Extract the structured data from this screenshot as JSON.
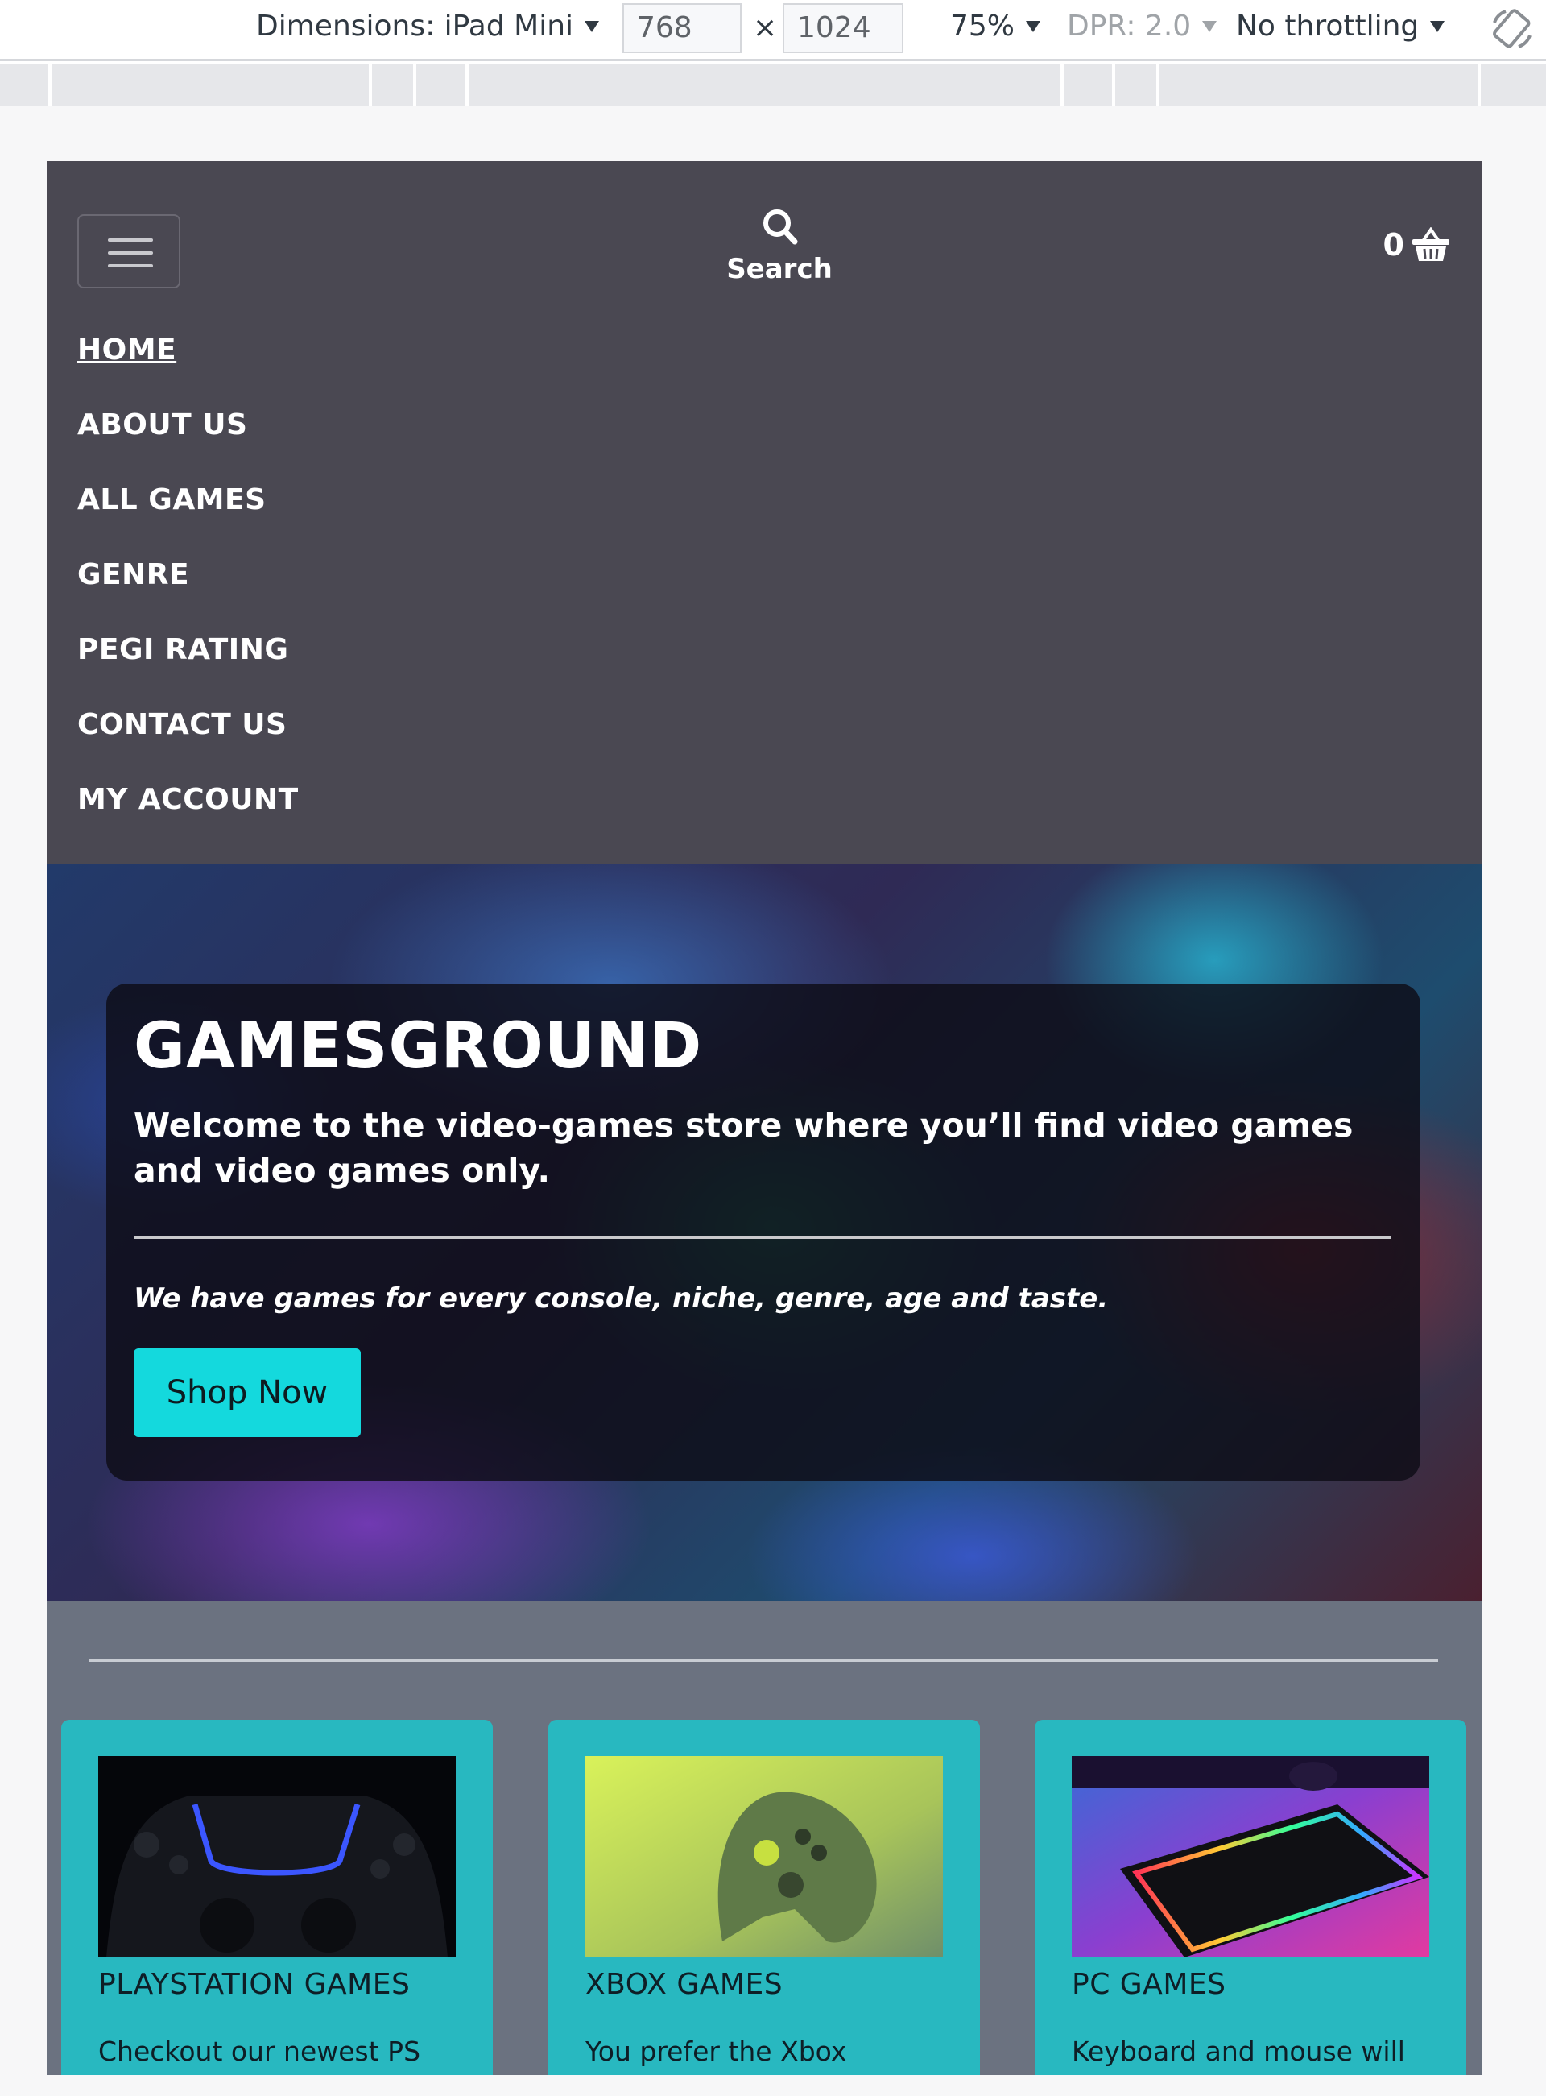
{
  "devtools": {
    "dimensions_label": "Dimensions: iPad Mini",
    "width_value": "768",
    "times": "×",
    "height_value": "1024",
    "zoom": "75%",
    "dpr": "DPR: 2.0",
    "throttling": "No throttling",
    "rotate_icon": "rotate-icon"
  },
  "nav": {
    "toggler_icon": "hamburger-icon",
    "search_label": "Search",
    "search_icon": "search-icon",
    "basket_count": "0",
    "basket_icon": "basket-icon",
    "items": [
      {
        "label": "HOME",
        "active": true
      },
      {
        "label": "ABOUT US"
      },
      {
        "label": "ALL GAMES"
      },
      {
        "label": "GENRE"
      },
      {
        "label": "PEGI RATING"
      },
      {
        "label": "CONTACT US"
      },
      {
        "label": "MY ACCOUNT"
      }
    ]
  },
  "hero": {
    "title": "GAMESGROUND",
    "lead": "Welcome to the video-games store where you’ll find video games and video games only.",
    "sub": "We have games for every console, niche, genre, age and taste.",
    "button": "Shop Now"
  },
  "cards": [
    {
      "title": "PLAYSTATION GAMES",
      "text": "Checkout our newest PS"
    },
    {
      "title": "XBOX GAMES",
      "text": "You prefer the Xbox"
    },
    {
      "title": "PC GAMES",
      "text": "Keyboard and mouse will"
    }
  ],
  "colors": {
    "nav_bg": "#4a4852",
    "accent": "#14d9dd",
    "card_bg": "#28b8c0",
    "section_bg": "#6b7280"
  }
}
